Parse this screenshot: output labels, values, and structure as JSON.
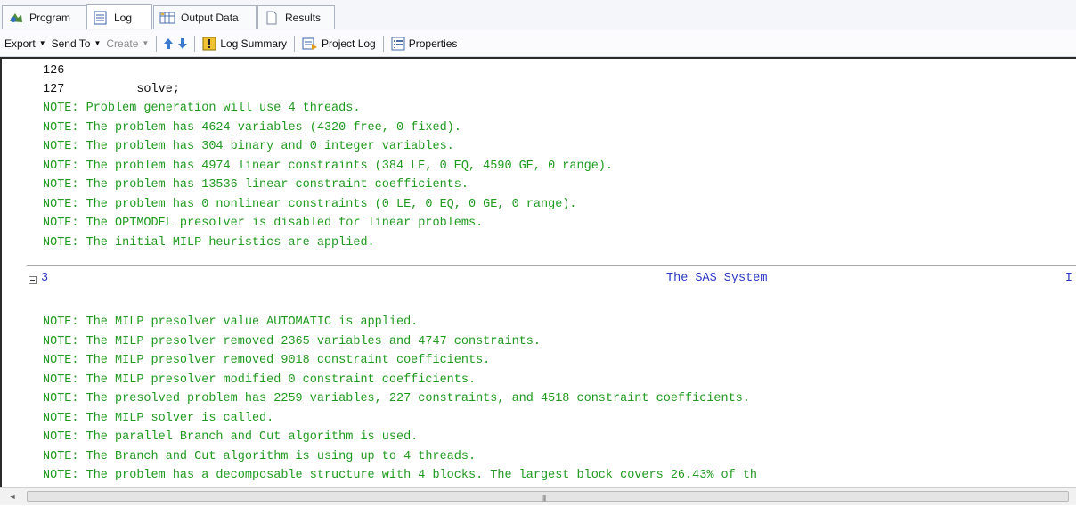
{
  "tabs": [
    {
      "label": "Program"
    },
    {
      "label": "Log"
    },
    {
      "label": "Output Data"
    },
    {
      "label": "Results"
    }
  ],
  "toolbar": {
    "export": "Export",
    "send_to": "Send To",
    "create": "Create",
    "log_summary": "Log Summary",
    "project_log": "Project Log",
    "properties": "Properties"
  },
  "log": {
    "lines_before": [
      {
        "text": "126",
        "kind": "code"
      },
      {
        "text": "127          solve;",
        "kind": "code"
      },
      {
        "text": "NOTE: Problem generation will use 4 threads.",
        "kind": "note"
      },
      {
        "text": "NOTE: The problem has 4624 variables (4320 free, 0 fixed).",
        "kind": "note"
      },
      {
        "text": "NOTE: The problem has 304 binary and 0 integer variables.",
        "kind": "note"
      },
      {
        "text": "NOTE: The problem has 4974 linear constraints (384 LE, 0 EQ, 4590 GE, 0 range).",
        "kind": "note"
      },
      {
        "text": "NOTE: The problem has 13536 linear constraint coefficients.",
        "kind": "note"
      },
      {
        "text": "NOTE: The problem has 0 nonlinear constraints (0 LE, 0 EQ, 0 GE, 0 range).",
        "kind": "note"
      },
      {
        "text": "NOTE: The OPTMODEL presolver is disabled for linear problems.",
        "kind": "note"
      },
      {
        "text": "NOTE: The initial MILP heuristics are applied.",
        "kind": "note"
      }
    ],
    "page_header": {
      "page_number": "3",
      "system_title": "The SAS System",
      "cut_char": "I"
    },
    "lines_after": [
      {
        "text": "NOTE: The MILP presolver value AUTOMATIC is applied.",
        "kind": "note"
      },
      {
        "text": "NOTE: The MILP presolver removed 2365 variables and 4747 constraints.",
        "kind": "note"
      },
      {
        "text": "NOTE: The MILP presolver removed 9018 constraint coefficients.",
        "kind": "note"
      },
      {
        "text": "NOTE: The MILP presolver modified 0 constraint coefficients.",
        "kind": "note"
      },
      {
        "text": "NOTE: The presolved problem has 2259 variables, 227 constraints, and 4518 constraint coefficients.",
        "kind": "note"
      },
      {
        "text": "NOTE: The MILP solver is called.",
        "kind": "note"
      },
      {
        "text": "NOTE: The parallel Branch and Cut algorithm is used.",
        "kind": "note"
      },
      {
        "text": "NOTE: The Branch and Cut algorithm is using up to 4 threads.",
        "kind": "note"
      },
      {
        "text": "NOTE: The problem has a decomposable structure with 4 blocks. The largest block covers 26.43% of th",
        "kind": "note"
      }
    ]
  },
  "colors": {
    "note_text": "#1f9a1f",
    "code_text": "#111111",
    "page_header": "#2a38c7"
  }
}
